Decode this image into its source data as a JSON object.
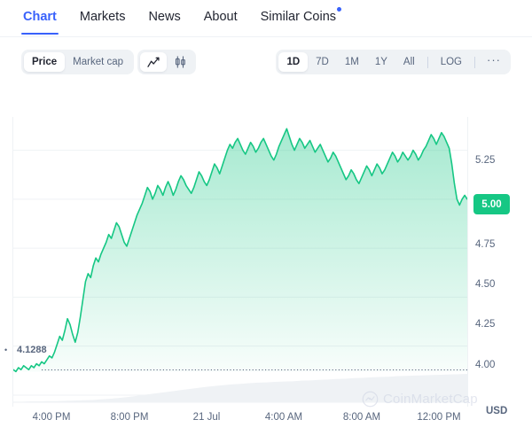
{
  "nav": {
    "tabs": [
      {
        "label": "Chart",
        "active": true,
        "badge": false
      },
      {
        "label": "Markets",
        "active": false,
        "badge": false
      },
      {
        "label": "News",
        "active": false,
        "badge": false
      },
      {
        "label": "About",
        "active": false,
        "badge": false
      },
      {
        "label": "Similar Coins",
        "active": false,
        "badge": true
      }
    ]
  },
  "toolbar": {
    "metric_options": [
      {
        "label": "Price",
        "selected": true
      },
      {
        "label": "Market cap",
        "selected": false
      }
    ],
    "chart_type": [
      {
        "icon": "line-chart-icon",
        "selected": true
      },
      {
        "icon": "candlestick-chart-icon",
        "selected": false
      }
    ],
    "ranges": [
      {
        "label": "1D",
        "selected": true
      },
      {
        "label": "7D",
        "selected": false
      },
      {
        "label": "1M",
        "selected": false
      },
      {
        "label": "1Y",
        "selected": false
      },
      {
        "label": "All",
        "selected": false
      }
    ],
    "log_label": "LOG",
    "more_label": "···"
  },
  "colors": {
    "accent_blue": "#3861FB",
    "line_green": "#16C784",
    "area_green": "#16C784",
    "grid": "#EFF2F5",
    "text_muted": "#58667E",
    "volume_grey": "#EFF2F5"
  },
  "watermark": {
    "text": "CoinMarketCap",
    "logo": "coinmarketcap-logo-icon"
  },
  "chart_data": {
    "type": "area",
    "title": "",
    "xlabel": "",
    "ylabel": "USD",
    "currency": "USD",
    "ylim": [
      3.95,
      5.42
    ],
    "yticks": [
      5.25,
      5.0,
      4.75,
      4.5,
      4.25,
      4.0
    ],
    "ytick_labels": [
      "5.25",
      "5.00",
      "4.75",
      "4.50",
      "4.25",
      "4.00"
    ],
    "current_price_label": "5.00",
    "current_price": 5.0,
    "reference_line": {
      "label": "4.1288",
      "value": 4.1288,
      "style": "dotted"
    },
    "grid": true,
    "legend": false,
    "xtick_labels": [
      "4:00 PM",
      "8:00 PM",
      "21 Jul",
      "4:00 AM",
      "8:00 AM",
      "12:00 PM"
    ],
    "xtick_positions_pct": [
      8.6,
      25.7,
      42.6,
      59.5,
      76.6,
      93.6
    ],
    "series": [
      {
        "name": "Price",
        "color": "#16C784",
        "values": [
          4.13,
          4.12,
          4.14,
          4.13,
          4.15,
          4.14,
          4.13,
          4.15,
          4.14,
          4.16,
          4.15,
          4.17,
          4.16,
          4.18,
          4.2,
          4.19,
          4.22,
          4.26,
          4.3,
          4.28,
          4.33,
          4.39,
          4.36,
          4.31,
          4.27,
          4.32,
          4.4,
          4.49,
          4.58,
          4.62,
          4.6,
          4.66,
          4.7,
          4.68,
          4.72,
          4.75,
          4.78,
          4.82,
          4.8,
          4.84,
          4.88,
          4.86,
          4.82,
          4.78,
          4.76,
          4.8,
          4.84,
          4.88,
          4.92,
          4.95,
          4.98,
          5.02,
          5.06,
          5.04,
          5.0,
          5.03,
          5.07,
          5.05,
          5.02,
          5.06,
          5.09,
          5.06,
          5.02,
          5.05,
          5.09,
          5.12,
          5.1,
          5.07,
          5.05,
          5.03,
          5.06,
          5.1,
          5.14,
          5.12,
          5.09,
          5.07,
          5.1,
          5.14,
          5.18,
          5.16,
          5.13,
          5.17,
          5.21,
          5.25,
          5.28,
          5.26,
          5.29,
          5.31,
          5.28,
          5.25,
          5.23,
          5.26,
          5.29,
          5.27,
          5.24,
          5.26,
          5.29,
          5.31,
          5.28,
          5.25,
          5.22,
          5.2,
          5.23,
          5.27,
          5.3,
          5.33,
          5.36,
          5.32,
          5.28,
          5.25,
          5.28,
          5.31,
          5.29,
          5.26,
          5.28,
          5.3,
          5.27,
          5.24,
          5.26,
          5.28,
          5.25,
          5.22,
          5.19,
          5.21,
          5.24,
          5.22,
          5.19,
          5.16,
          5.13,
          5.1,
          5.12,
          5.15,
          5.13,
          5.1,
          5.08,
          5.11,
          5.14,
          5.17,
          5.15,
          5.12,
          5.15,
          5.18,
          5.16,
          5.13,
          5.15,
          5.18,
          5.21,
          5.24,
          5.22,
          5.19,
          5.21,
          5.24,
          5.22,
          5.2,
          5.22,
          5.25,
          5.23,
          5.2,
          5.22,
          5.25,
          5.27,
          5.3,
          5.33,
          5.31,
          5.28,
          5.31,
          5.34,
          5.32,
          5.29,
          5.26,
          5.18,
          5.08,
          5.0,
          4.97,
          5.0,
          5.02,
          5.0
        ]
      }
    ],
    "volume_series": {
      "name": "Volume",
      "color": "#EFF2F5",
      "values": [
        0.02,
        0.02,
        0.03,
        0.03,
        0.04,
        0.04,
        0.05,
        0.06,
        0.07,
        0.08,
        0.1,
        0.12,
        0.15,
        0.18,
        0.22,
        0.26,
        0.3,
        0.34,
        0.38,
        0.42,
        0.46,
        0.5,
        0.54,
        0.57,
        0.6,
        0.63,
        0.65,
        0.67,
        0.69,
        0.7,
        0.72,
        0.73,
        0.74,
        0.76,
        0.77,
        0.79,
        0.8,
        0.82,
        0.83,
        0.85,
        0.86,
        0.88,
        0.89,
        0.9,
        0.92,
        0.93,
        0.94,
        0.95,
        0.96,
        0.97,
        0.98,
        0.99,
        1.0
      ]
    }
  }
}
